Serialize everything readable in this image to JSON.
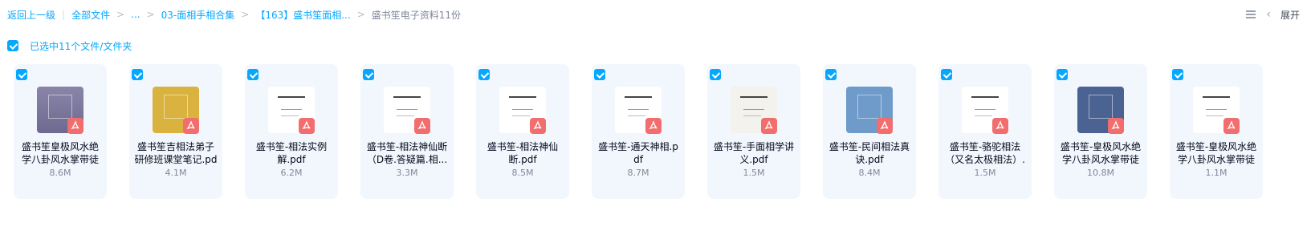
{
  "breadcrumb": {
    "back": "返回上一级",
    "all_files": "全部文件",
    "ellipsis": "...",
    "level1": "03-面相手相合集",
    "level2": "【163】盛书笙面相...",
    "current": "盛书笙电子资料11份",
    "separator": ">"
  },
  "toolbar": {
    "list_view_icon": "list-view-icon",
    "collapse_icon": "chevron-left-icon",
    "collapse_glyph": "‹",
    "expand_label": "展开"
  },
  "selection": {
    "label": "已选中11个文件/文件夹",
    "checked": true
  },
  "colors": {
    "accent": "#06a7ff",
    "card_bg": "#f1f7fd",
    "pdf_badge": "#f26d6d"
  },
  "files": [
    {
      "name": "盛书笙皇极风水绝学八卦风水掌带徒",
      "size": "8.6M",
      "thumb": "purple-cover"
    },
    {
      "name": "盛书笙吉相法弟子研修班课堂笔记.pd",
      "size": "4.1M",
      "thumb": "yellow-cover"
    },
    {
      "name": "盛书笙-相法实例解.pdf",
      "size": "6.2M",
      "thumb": "white-title"
    },
    {
      "name": "盛书笙-相法神仙断（D卷.答疑篇.相...",
      "size": "3.3M",
      "thumb": "white-title"
    },
    {
      "name": "盛书笙-相法神仙断.pdf",
      "size": "8.5M",
      "thumb": "white-text"
    },
    {
      "name": "盛书笙-通天神相.pdf",
      "size": "8.7M",
      "thumb": "white-text"
    },
    {
      "name": "盛书笙-手面相学讲义.pdf",
      "size": "1.5M",
      "thumb": "hand-drawing"
    },
    {
      "name": "盛书笙-民间相法真诀.pdf",
      "size": "8.4M",
      "thumb": "blue-cover"
    },
    {
      "name": "盛书笙-骆驼相法（又名太极相法）.",
      "size": "1.5M",
      "thumb": "white-title"
    },
    {
      "name": "盛书笙-皇极风水绝学八卦风水掌带徒",
      "size": "10.8M",
      "thumb": "navy-cover"
    },
    {
      "name": "盛书笙-皇极风水绝学八卦风水掌带徒",
      "size": "1.1M",
      "thumb": "white-text"
    }
  ]
}
